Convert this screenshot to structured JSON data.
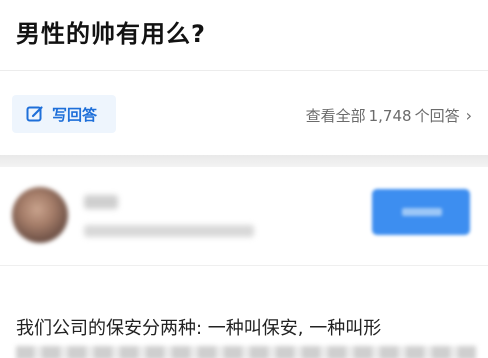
{
  "question": {
    "title": "男性的帅有用么?"
  },
  "actions": {
    "write_answer_label": "写回答",
    "view_all_prefix": "查看全部",
    "answer_count": "1,748",
    "view_all_suffix": "个回答",
    "chevron": "›"
  },
  "answer": {
    "text_first_line": "我们公司的保安分两种: 一种叫保安, 一种叫形"
  },
  "colors": {
    "accent": "#1e6fd9",
    "button_bg": "#eef5fd",
    "follow_button": "#3d8ef0"
  },
  "icons": {
    "write_answer": "pencil-square-icon",
    "view_all": "chevron-right-icon"
  }
}
